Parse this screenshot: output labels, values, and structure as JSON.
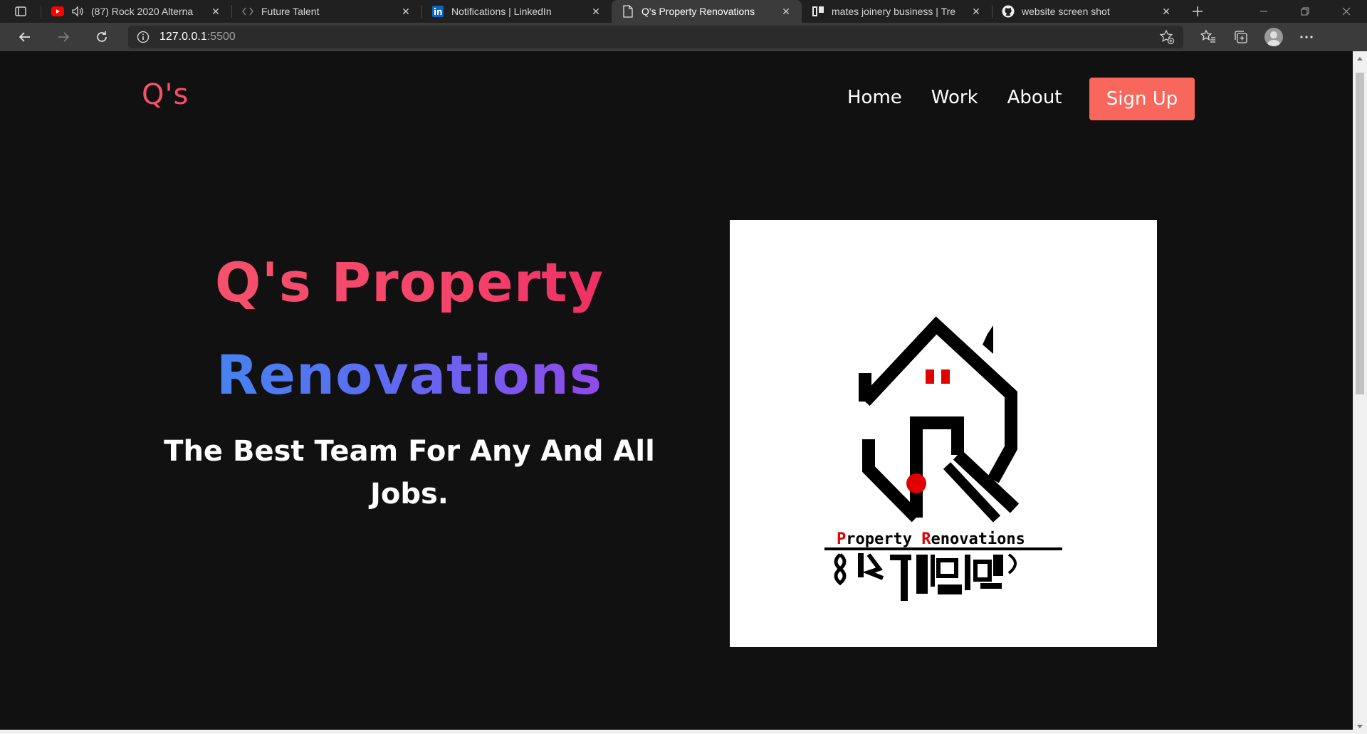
{
  "browser": {
    "tabs": [
      {
        "title": "(87) Rock 2020 Alterna",
        "favicon": "youtube-icon",
        "audio": "speaker-icon",
        "active": false
      },
      {
        "title": "Future Talent",
        "favicon": "code-icon",
        "active": false
      },
      {
        "title": "Notifications | LinkedIn",
        "favicon": "linkedin-icon",
        "active": false
      },
      {
        "title": "Q's Property Renovations",
        "favicon": "page-icon",
        "active": true
      },
      {
        "title": "mates joinery business | Tre",
        "favicon": "board-icon",
        "active": false
      },
      {
        "title": "website screen shot",
        "favicon": "github-icon",
        "active": false
      }
    ],
    "address": {
      "host": "127.0.0.1",
      "port": ":5500"
    },
    "accent": "#3b3b3b"
  },
  "site": {
    "brand": "Q's",
    "nav": {
      "home": "Home",
      "work": "Work",
      "about": "About",
      "signup": "Sign Up"
    },
    "hero": {
      "title_line1": "Q's Property",
      "title_line2": "Renovations",
      "subtitle": "The Best Team For Any And All Jobs."
    },
    "logo": {
      "caption": "Property Renovations",
      "caption_initial_1": "P",
      "caption_initial_2": "R"
    },
    "colors": {
      "brand": "#f7506a",
      "signup_bg": "#f8665c",
      "background": "#111111",
      "gradient_blue": "#3a8ff2",
      "gradient_purple": "#a445e8"
    }
  }
}
